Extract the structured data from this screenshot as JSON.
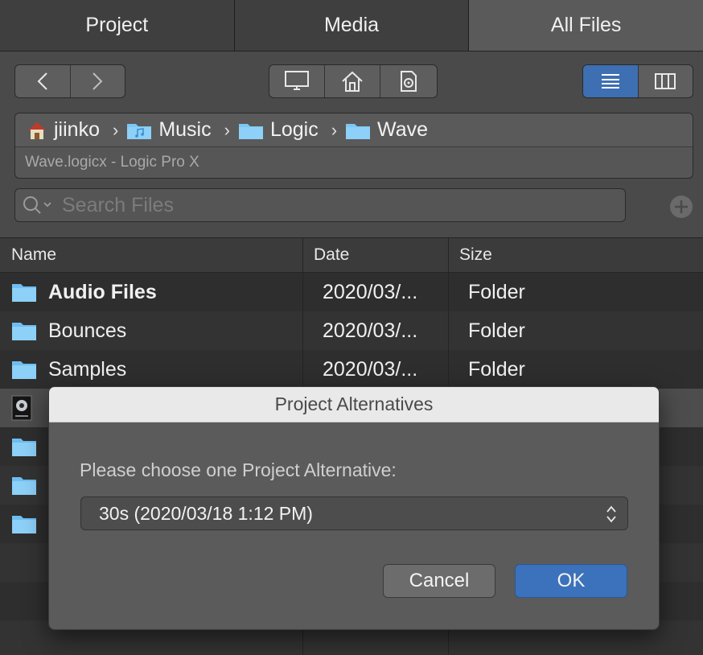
{
  "tabs": [
    {
      "label": "Project"
    },
    {
      "label": "Media"
    },
    {
      "label": "All Files"
    }
  ],
  "path": {
    "crumbs": [
      "jiinko",
      "Music",
      "Logic",
      "Wave"
    ],
    "separator": "›",
    "subtitle": "Wave.logicx - Logic Pro X"
  },
  "search": {
    "placeholder": "Search Files"
  },
  "list": {
    "headers": {
      "name": "Name",
      "date": "Date",
      "size": "Size"
    },
    "rows": [
      {
        "name": "Audio Files",
        "date": "2020/03/...",
        "size": "Folder",
        "icon": "folder-icon"
      },
      {
        "name": "Bounces",
        "date": "2020/03/...",
        "size": "Folder",
        "icon": "folder-icon"
      },
      {
        "name": "Samples",
        "date": "2020/03/...",
        "size": "Folder",
        "icon": "folder-icon"
      },
      {
        "name": "",
        "date": "",
        "size": "",
        "icon": "logic-project-icon"
      },
      {
        "name": "",
        "date": "",
        "size": "",
        "icon": "folder-icon"
      },
      {
        "name": "",
        "date": "",
        "size": "",
        "icon": "folder-icon"
      },
      {
        "name": "",
        "date": "",
        "size": "",
        "icon": "folder-icon"
      }
    ]
  },
  "dialog": {
    "title": "Project Alternatives",
    "prompt": "Please choose one Project Alternative:",
    "selected_alternative": "30s  (2020/03/18 1:12 PM)",
    "cancel_label": "Cancel",
    "ok_label": "OK"
  },
  "colors": {
    "accent": "#3c72bb",
    "folder": "#7cc6f4"
  }
}
